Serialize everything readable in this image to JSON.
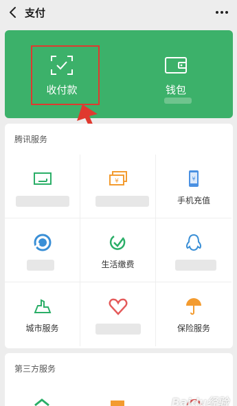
{
  "header": {
    "title": "支付",
    "more_label": "···"
  },
  "wallet_panel": {
    "collect_pay_label": "收付款",
    "wallet_label": "钱包"
  },
  "tencent_services": {
    "title": "腾讯服务",
    "items": [
      {
        "label": "",
        "icon": "card-icon",
        "color": "#2aae67"
      },
      {
        "label": "",
        "icon": "money-icon",
        "color": "#f39b2f"
      },
      {
        "label": "手机充值",
        "icon": "phone-topup-icon",
        "color": "#4a90e2"
      },
      {
        "label": "",
        "icon": "wealth-icon",
        "color": "#3a8fd6"
      },
      {
        "label": "生活缴费",
        "icon": "utility-check-icon",
        "color": "#2aae67"
      },
      {
        "label": "",
        "icon": "qq-icon",
        "color": "#3a8fd6"
      },
      {
        "label": "城市服务",
        "icon": "city-icon",
        "color": "#2aae67"
      },
      {
        "label": "",
        "icon": "heart-icon",
        "color": "#e45a5a"
      },
      {
        "label": "保险服务",
        "icon": "umbrella-icon",
        "color": "#f39b2f"
      }
    ]
  },
  "third_party": {
    "title": "第三方服务"
  },
  "watermark": "Baidu经验"
}
